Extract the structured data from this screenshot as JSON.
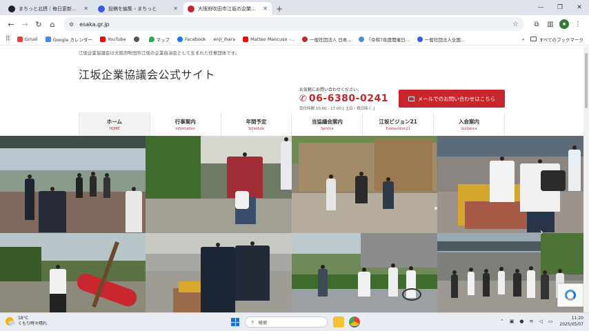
{
  "browser": {
    "tabs": [
      {
        "title": "まちっと北摂｜毎日更新！北摂エ",
        "favicon_color": "#222222",
        "active": false
      },
      {
        "title": "投稿を編集 ‹ まちっと",
        "favicon_color": "#3858e9",
        "active": false
      },
      {
        "title": "大阪府吹田市江坂の企業自治",
        "favicon_color": "#c1272d",
        "active": true
      }
    ],
    "new_tab": "+",
    "window_controls": [
      "—",
      "❐",
      "✕"
    ],
    "url": "esaka.gr.jp",
    "bookmarks": [
      {
        "label": "Gmail",
        "color": "#ea4335"
      },
      {
        "label": "Google カレンダー",
        "color": "#4285f4"
      },
      {
        "label": "YouTube",
        "color": "#ff0000"
      },
      {
        "label": "",
        "color": "#555555"
      },
      {
        "label": "マップ",
        "color": "#34a853"
      },
      {
        "label": "Facebook",
        "color": "#1877f2"
      },
      {
        "label": "enji_ihara",
        "color": "#999999"
      },
      {
        "label": "Matteo Mancuso -...",
        "color": "#ff0000"
      },
      {
        "label": "一般社団法人 日本...",
        "color": "#c1272d"
      },
      {
        "label": "「令和7年度開催日...",
        "color": "#4a90d9"
      },
      {
        "label": "一般社団法人全国...",
        "color": "#3858e9"
      }
    ],
    "bookmarks_more": "»",
    "bookmarks_folder": "すべてのブックマーク"
  },
  "site": {
    "tagline": "江坂企業協議会は大阪府吹田市江坂の企業自治会として生まれた任意団体です。",
    "title": "江坂企業協議会公式サイト",
    "contact": {
      "lead": "お気軽にお問い合わせください。",
      "phone": "06-6380-0241",
      "hours": "受付時間 10:00 - 17:00 [ 土日・祝日除く ]"
    },
    "mail_button": "メールでのお問い合わせはこちら",
    "nav": [
      {
        "jp": "ホーム",
        "en": "HOME"
      },
      {
        "jp": "行事案内",
        "en": "Information"
      },
      {
        "jp": "年間予定",
        "en": "Schedule"
      },
      {
        "jp": "当協議会案内",
        "en": "Service"
      },
      {
        "jp": "江坂ビジョン21",
        "en": "Esakavision21"
      },
      {
        "jp": "入会案内",
        "en": "Guidance"
      }
    ],
    "slider_next": "›"
  },
  "taskbar": {
    "weather_temp": "18°C",
    "weather_desc": "くもり時々晴れ",
    "search_placeholder": "検索",
    "time": "11:20",
    "date": "2025/05/07"
  }
}
